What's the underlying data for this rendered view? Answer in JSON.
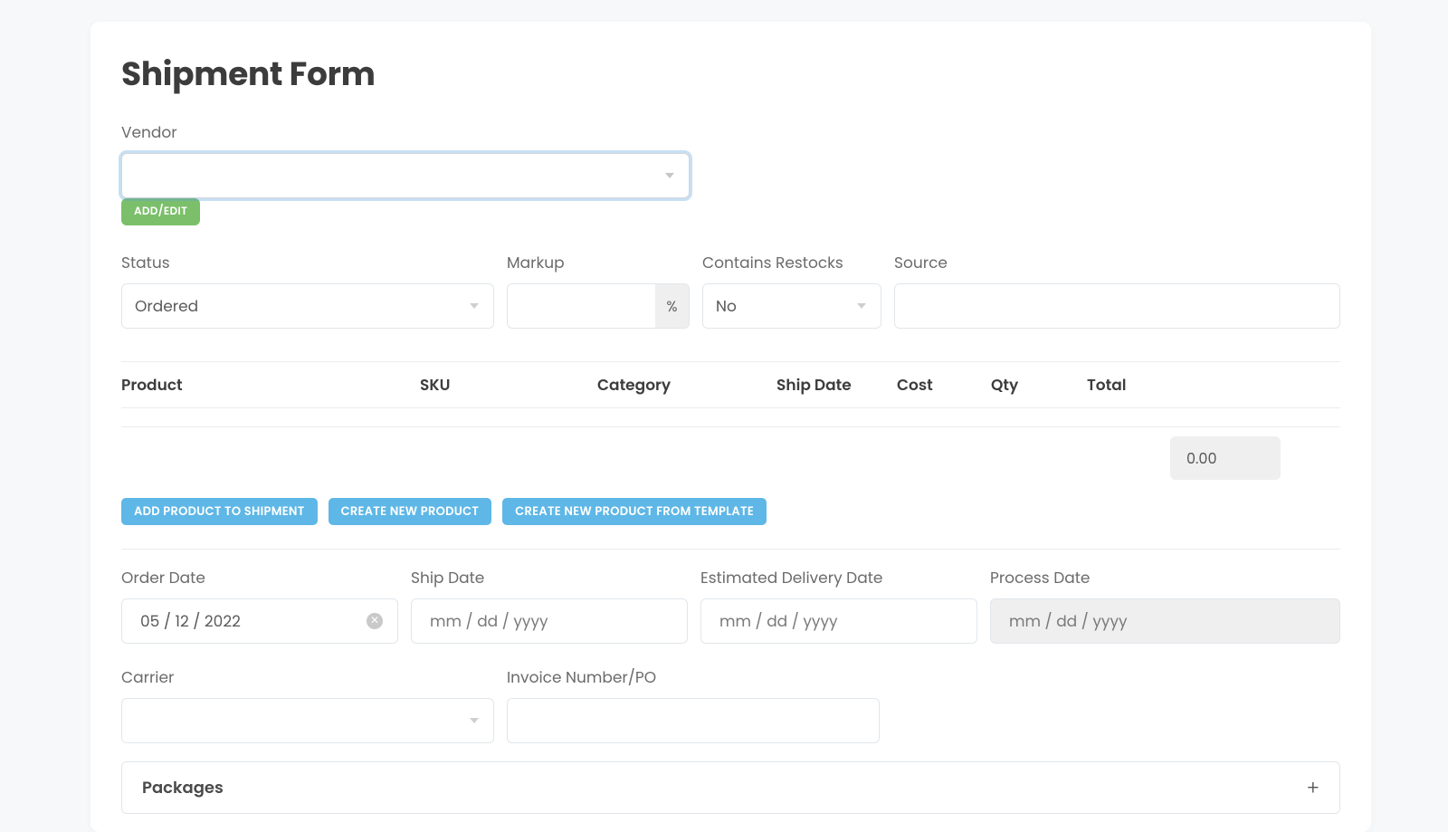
{
  "title": "Shipment Form",
  "vendor": {
    "label": "Vendor",
    "value": "",
    "addEditLabel": "ADD/EDIT"
  },
  "status": {
    "label": "Status",
    "value": "Ordered"
  },
  "markup": {
    "label": "Markup",
    "value": "",
    "suffix": "%"
  },
  "restocks": {
    "label": "Contains Restocks",
    "value": "No"
  },
  "source": {
    "label": "Source",
    "value": ""
  },
  "table": {
    "headers": {
      "product": "Product",
      "sku": "SKU",
      "category": "Category",
      "shipDate": "Ship Date",
      "cost": "Cost",
      "qty": "Qty",
      "total": "Total"
    },
    "totalValue": "0.00"
  },
  "buttons": {
    "addProduct": "ADD PRODUCT TO SHIPMENT",
    "createProduct": "CREATE NEW PRODUCT",
    "createTemplate": "CREATE NEW PRODUCT FROM TEMPLATE"
  },
  "dates": {
    "order": {
      "label": "Order Date",
      "value": "05 / 12 / 2022"
    },
    "ship": {
      "label": "Ship Date",
      "placeholder": "mm / dd / yyyy"
    },
    "estDelivery": {
      "label": "Estimated Delivery Date",
      "placeholder": "mm / dd / yyyy"
    },
    "process": {
      "label": "Process Date",
      "placeholder": "mm / dd / yyyy"
    }
  },
  "carrier": {
    "label": "Carrier",
    "value": ""
  },
  "invoice": {
    "label": "Invoice Number/PO",
    "value": ""
  },
  "packages": {
    "label": "Packages"
  }
}
